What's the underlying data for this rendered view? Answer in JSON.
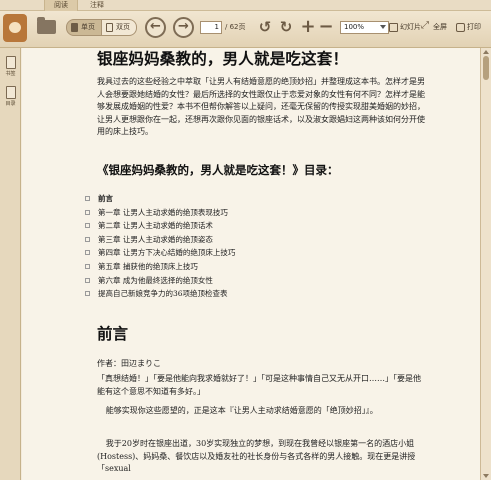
{
  "tabs": {
    "read": "阅读",
    "notes": "注释"
  },
  "toolbar": {
    "single_page": "单页",
    "double_page": "双页",
    "page_current": "1",
    "page_total": "/ 62页",
    "zoom": "100%",
    "slideshow": "幻灯片",
    "fullscreen": "全屏",
    "print": "打印"
  },
  "sidebar": {
    "bookmark": "书签",
    "toc": "目录"
  },
  "doc": {
    "title": "银座妈妈桑教的，男人就是吃这套！",
    "intro": "我具过去的这些经验之中萃取「让男人有结婚意愿的绝顶妙招」并整理成这本书。怎样才是男人会想要跟她结婚的女性？最后所选择的女性跟仅止于恋爱对象的女性有何不同？怎样才是能够发展成婚姻的性爱？本书不但帮你解答以上疑问，还毫无保留的传授实现甜美婚姻的妙招，让男人更想跟你在一起，还想再次跟你见面的银座话术，以及淑女跟娼妇这两种该如何分开使用的床上技巧。",
    "toc_title": "《银座妈妈桑教的，男人就是吃这套！》目录：",
    "toc": [
      "前言",
      "第一章 让男人主动求婚的绝顶表现技巧",
      "第二章 让男人主动求婚的绝顶话术",
      "第三章 让男人主动求婚的绝顶姿态",
      "第四章 让男方下决心结婚的绝顶床上技巧",
      "第五章 捕获他的绝顶床上技巧",
      "第六章 成为他最终选择的绝顶女性",
      "提高自己新娘竞争力的36项绝顶检查表"
    ],
    "section_title": "前言",
    "author": "作者：田辺まりこ",
    "p1": "「真想结婚！」「要是他能向我求婚就好了！」「可是这种事情自己又无从开口……」「要是他能有这个意思不知道有多好。」",
    "p2": "能够实现你这些愿望的，正是这本『让男人主动求结婚意愿的「绝顶妙招」』。",
    "p3": "我于20岁时在银座出道，30岁实现独立的梦想，到现在我曾经以银座第一名的酒店小姐(Hostess)、妈妈桑、餐饮店以及婚友社的社长身份与各式各样的男人接触。现在更是讲授「sexual"
  }
}
